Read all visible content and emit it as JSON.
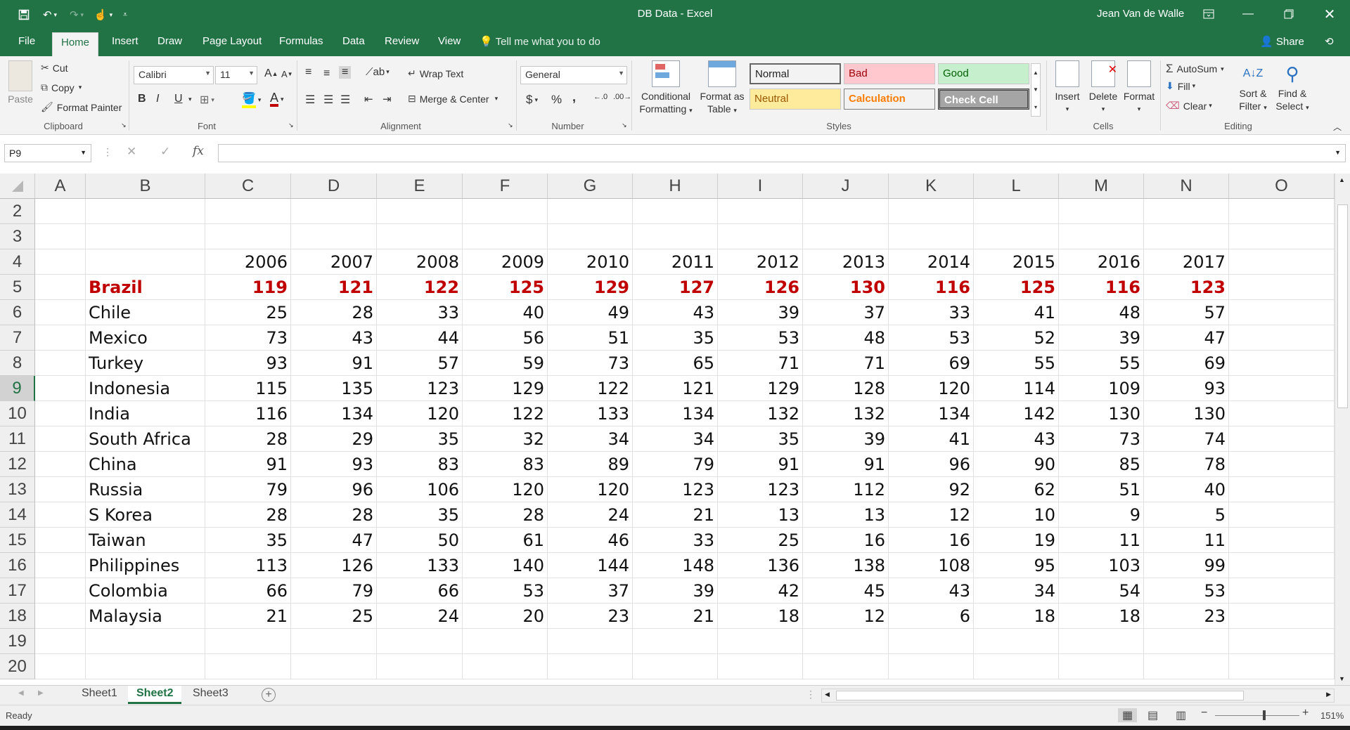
{
  "titlebar": {
    "doc_title": "DB Data  -  Excel",
    "user": "Jean Van de Walle"
  },
  "ribbon_tabs": [
    "File",
    "Home",
    "Insert",
    "Draw",
    "Page Layout",
    "Formulas",
    "Data",
    "Review",
    "View"
  ],
  "active_tab": "Home",
  "tell_me": "Tell me what you to do",
  "share": "Share",
  "clipboard": {
    "paste": "Paste",
    "cut": "Cut",
    "copy": "Copy",
    "format_painter": "Format Painter",
    "label": "Clipboard"
  },
  "font": {
    "name": "Calibri",
    "size": "11",
    "bold": "B",
    "italic": "I",
    "underline": "U",
    "label": "Font"
  },
  "alignment": {
    "wrap_text": "Wrap Text",
    "merge_center": "Merge & Center",
    "label": "Alignment"
  },
  "number": {
    "format": "General",
    "currency": "$",
    "percent": "%",
    "comma": ",",
    "label": "Number"
  },
  "styles": {
    "conditional_formatting": [
      "Conditional",
      "Formatting"
    ],
    "format_as_table": [
      "Format as",
      "Table"
    ],
    "cells": [
      {
        "name": "Normal",
        "bg": "#ffffff",
        "fg": "#000000"
      },
      {
        "name": "Bad",
        "bg": "#ffc7ce",
        "fg": "#9c0006"
      },
      {
        "name": "Good",
        "bg": "#c6efce",
        "fg": "#006100"
      },
      {
        "name": "Neutral",
        "bg": "#ffeb9c",
        "fg": "#9c5700"
      },
      {
        "name": "Calculation",
        "bg": "#f2f2f2",
        "fg": "#fa7d00"
      },
      {
        "name": "Check Cell",
        "bg": "#a5a5a5",
        "fg": "#ffffff"
      }
    ],
    "label": "Styles"
  },
  "cells_group": {
    "insert": "Insert",
    "delete": "Delete",
    "format": "Format",
    "label": "Cells"
  },
  "editing": {
    "autosum": "AutoSum",
    "fill": "Fill",
    "clear": "Clear",
    "sort_filter": [
      "Sort &",
      "Filter"
    ],
    "find_select": [
      "Find &",
      "Select"
    ],
    "label": "Editing"
  },
  "formula_bar": {
    "name_box": "P9",
    "fx": "fx",
    "value": ""
  },
  "grid": {
    "columns": [
      "A",
      "B",
      "C",
      "D",
      "E",
      "F",
      "G",
      "H",
      "I",
      "J",
      "K",
      "L",
      "M",
      "N",
      "O"
    ],
    "rows": [
      "2",
      "3",
      "4",
      "5",
      "6",
      "7",
      "8",
      "9",
      "10",
      "11",
      "12",
      "13",
      "14",
      "15",
      "16",
      "17",
      "18",
      "19",
      "20"
    ],
    "selected_row": "9",
    "years": [
      "2006",
      "2007",
      "2008",
      "2009",
      "2010",
      "2011",
      "2012",
      "2013",
      "2014",
      "2015",
      "2016",
      "2017"
    ],
    "data": [
      {
        "country": "Brazil",
        "values": [
          "119",
          "121",
          "122",
          "125",
          "129",
          "127",
          "126",
          "130",
          "116",
          "125",
          "116",
          "123"
        ]
      },
      {
        "country": "Chile",
        "values": [
          "25",
          "28",
          "33",
          "40",
          "49",
          "43",
          "39",
          "37",
          "33",
          "41",
          "48",
          "57"
        ]
      },
      {
        "country": "Mexico",
        "values": [
          "73",
          "43",
          "44",
          "56",
          "51",
          "35",
          "53",
          "48",
          "53",
          "52",
          "39",
          "47"
        ]
      },
      {
        "country": "Turkey",
        "values": [
          "93",
          "91",
          "57",
          "59",
          "73",
          "65",
          "71",
          "71",
          "69",
          "55",
          "55",
          "69"
        ]
      },
      {
        "country": "Indonesia",
        "values": [
          "115",
          "135",
          "123",
          "129",
          "122",
          "121",
          "129",
          "128",
          "120",
          "114",
          "109",
          "93"
        ]
      },
      {
        "country": "India",
        "values": [
          "116",
          "134",
          "120",
          "122",
          "133",
          "134",
          "132",
          "132",
          "134",
          "142",
          "130",
          "130"
        ]
      },
      {
        "country": "South Africa",
        "values": [
          "28",
          "29",
          "35",
          "32",
          "34",
          "34",
          "35",
          "39",
          "41",
          "43",
          "73",
          "74"
        ]
      },
      {
        "country": "China",
        "values": [
          "91",
          "93",
          "83",
          "83",
          "89",
          "79",
          "91",
          "91",
          "96",
          "90",
          "85",
          "78"
        ]
      },
      {
        "country": "Russia",
        "values": [
          "79",
          "96",
          "106",
          "120",
          "120",
          "123",
          "123",
          "112",
          "92",
          "62",
          "51",
          "40"
        ]
      },
      {
        "country": "S Korea",
        "values": [
          "28",
          "28",
          "35",
          "28",
          "24",
          "21",
          "13",
          "13",
          "12",
          "10",
          "9",
          "5"
        ]
      },
      {
        "country": "Taiwan",
        "values": [
          "35",
          "47",
          "50",
          "61",
          "46",
          "33",
          "25",
          "16",
          "16",
          "19",
          "11",
          "11"
        ]
      },
      {
        "country": "Philippines",
        "values": [
          "113",
          "126",
          "133",
          "140",
          "144",
          "148",
          "136",
          "138",
          "108",
          "95",
          "103",
          "99"
        ]
      },
      {
        "country": "Colombia",
        "values": [
          "66",
          "79",
          "66",
          "53",
          "37",
          "39",
          "42",
          "45",
          "43",
          "34",
          "54",
          "53"
        ]
      },
      {
        "country": "Malaysia",
        "values": [
          "21",
          "25",
          "24",
          "20",
          "23",
          "21",
          "18",
          "12",
          "6",
          "18",
          "18",
          "23"
        ]
      }
    ]
  },
  "sheets": [
    "Sheet1",
    "Sheet2",
    "Sheet3"
  ],
  "active_sheet": "Sheet2",
  "status": {
    "ready": "Ready",
    "zoom": "151%"
  },
  "colors": {
    "excel_green": "#217346",
    "highlight_red": "#c00000"
  }
}
